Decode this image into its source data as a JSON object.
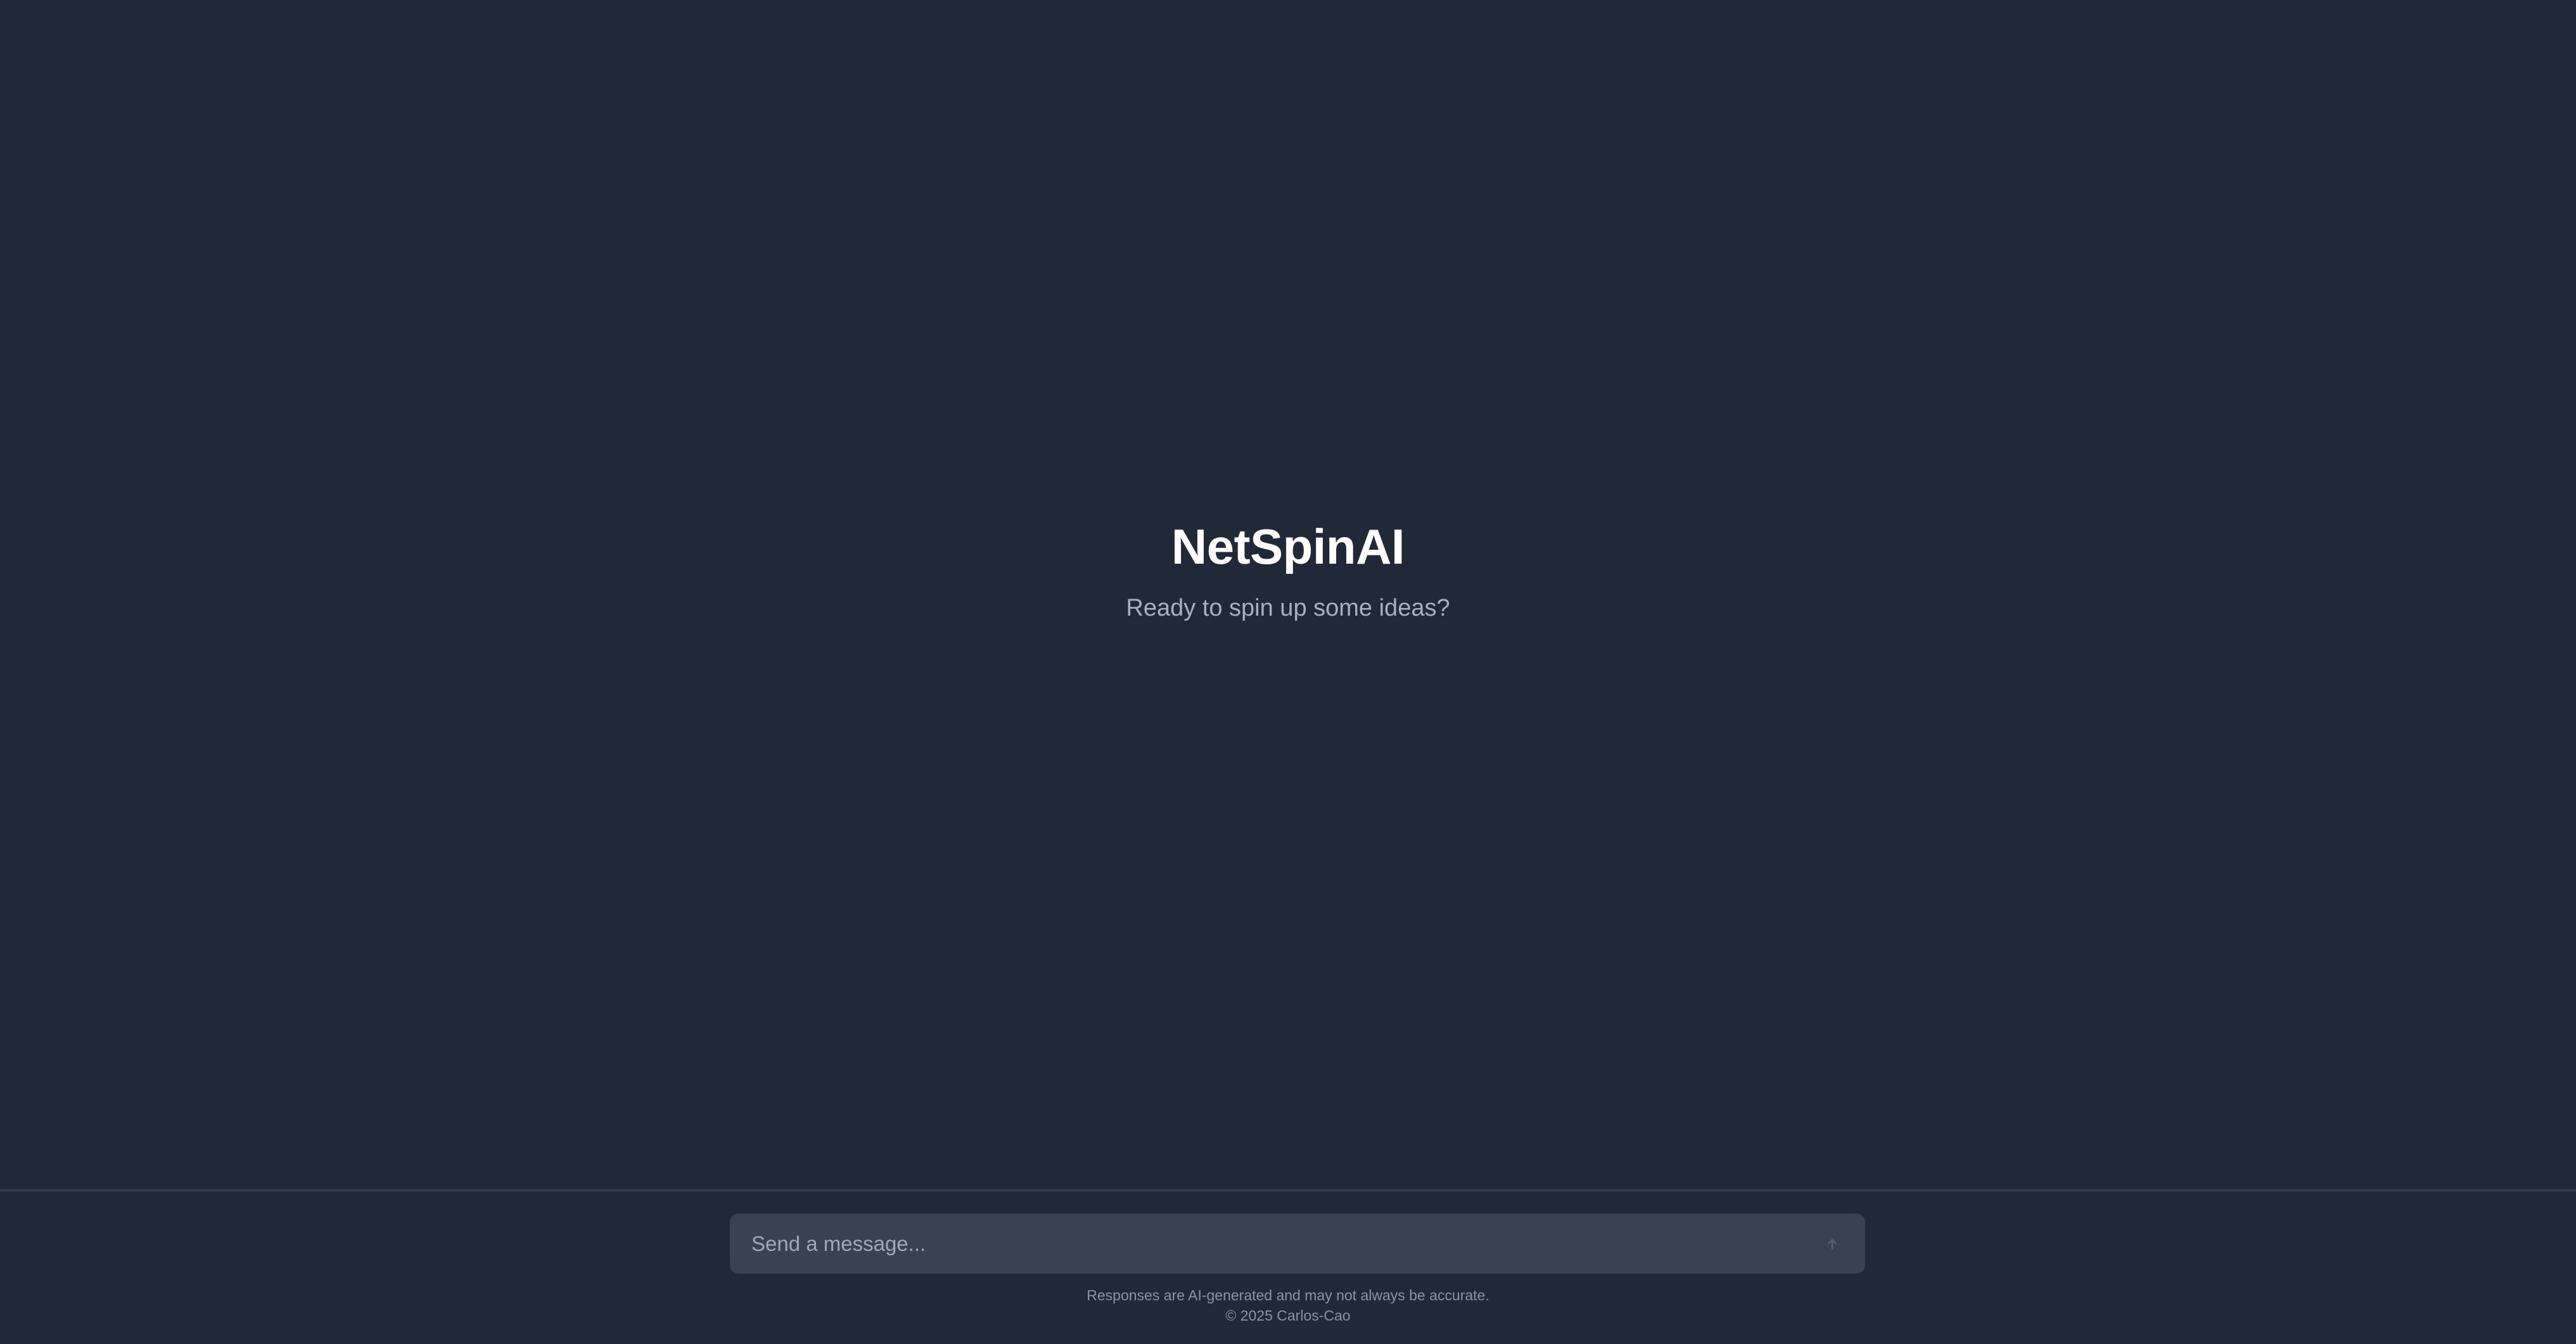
{
  "hero": {
    "title": "NetSpinAI",
    "subtitle": "Ready to spin up some ideas?"
  },
  "composer": {
    "placeholder": "Send a message...",
    "send_icon": "arrow-up-icon"
  },
  "footer": {
    "disclaimer": "Responses are AI-generated and may not always be accurate.",
    "copyright": "© 2025 Carlos-Cao"
  },
  "colors": {
    "background": "#212938",
    "input_background": "#3a4252",
    "title": "#ffffff",
    "subtitle": "#a7b0be",
    "footnote": "#8b93a1"
  }
}
